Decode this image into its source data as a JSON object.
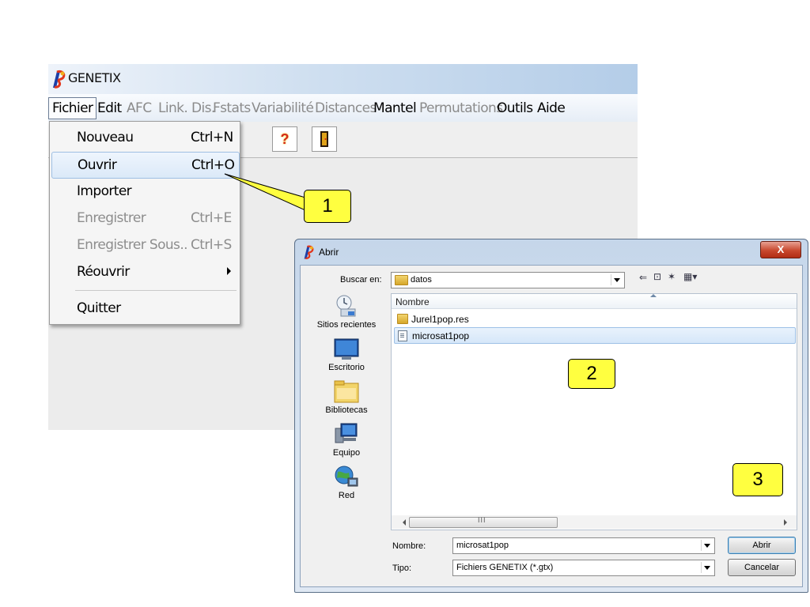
{
  "main_window": {
    "title": "GENETIX",
    "menu": [
      {
        "label": "Fichier",
        "state": "active"
      },
      {
        "label": "Edit",
        "state": "enabled"
      },
      {
        "label": "AFC",
        "state": "disabled"
      },
      {
        "label": "Link. Dis.",
        "state": "disabled"
      },
      {
        "label": "Fstats",
        "state": "disabled"
      },
      {
        "label": "Variabilité",
        "state": "disabled"
      },
      {
        "label": "Distances",
        "state": "disabled"
      },
      {
        "label": "Mantel",
        "state": "enabled"
      },
      {
        "label": "Permutations",
        "state": "disabled"
      },
      {
        "label": "Outils",
        "state": "enabled"
      },
      {
        "label": "Aide",
        "state": "enabled"
      }
    ],
    "toolbar": {
      "help_glyph": "?",
      "exit_glyph": "▮"
    }
  },
  "fichier_menu": {
    "items": [
      {
        "label": "Nouveau",
        "shortcut": "Ctrl+N",
        "enabled": true
      },
      {
        "label": "Ouvrir",
        "shortcut": "Ctrl+O",
        "enabled": true,
        "highlighted": true
      },
      {
        "label": "Importer",
        "shortcut": "",
        "enabled": true
      },
      {
        "label": "Enregistrer",
        "shortcut": "Ctrl+E",
        "enabled": false
      },
      {
        "label": "Enregistrer Sous..",
        "shortcut": "Ctrl+S",
        "enabled": false
      },
      {
        "label": "Réouvrir",
        "shortcut": "",
        "enabled": true,
        "submenu": true
      },
      {
        "label": "Quitter",
        "shortcut": "",
        "enabled": true
      }
    ]
  },
  "callouts": [
    "1",
    "2",
    "3"
  ],
  "callout_color": "#ffff40",
  "open_dialog": {
    "title": "Abrir",
    "close_label": "X",
    "look_in_label": "Buscar en:",
    "look_in_value": "datos",
    "places": [
      {
        "label": "Sitios recientes",
        "icon": "recent-places-icon"
      },
      {
        "label": "Escritorio",
        "icon": "desktop-icon"
      },
      {
        "label": "Bibliotecas",
        "icon": "libraries-icon"
      },
      {
        "label": "Equipo",
        "icon": "computer-icon"
      },
      {
        "label": "Red",
        "icon": "network-icon"
      }
    ],
    "column_header": "Nombre",
    "files": [
      {
        "name": "Jurel1pop.res",
        "type": "folder",
        "selected": false
      },
      {
        "name": "microsat1pop",
        "type": "file",
        "selected": true
      }
    ],
    "scroll_thumb_label": "III",
    "filename_label": "Nombre:",
    "filename_value": "microsat1pop",
    "filetype_label": "Tipo:",
    "filetype_value": "Fichiers GENETIX (*.gtx)",
    "open_button": "Abrir",
    "cancel_button": "Cancelar"
  }
}
